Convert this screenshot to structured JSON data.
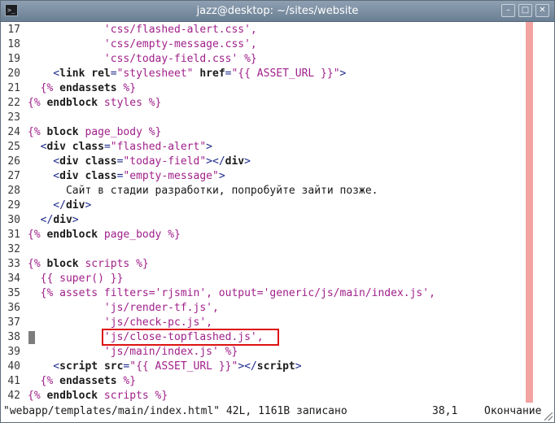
{
  "window": {
    "title": "jazz@desktop: ~/sites/website",
    "minimize_glyph": "–",
    "maximize_glyph": "□",
    "close_glyph": "✕",
    "app_icon": "terminal-icon"
  },
  "editor": {
    "lines": [
      {
        "num": "17",
        "tokens": [
          {
            "c": "string",
            "t": "            'css/flashed-alert.css',"
          }
        ]
      },
      {
        "num": "18",
        "tokens": [
          {
            "c": "string",
            "t": "            'css/empty-message.css',"
          }
        ]
      },
      {
        "num": "19",
        "tokens": [
          {
            "c": "string",
            "t": "            'css/today-field.css' %}"
          }
        ]
      },
      {
        "num": "20",
        "tokens": [
          {
            "c": "tag",
            "t": "    <"
          },
          {
            "c": "keyword",
            "t": "link"
          },
          {
            "c": "tag",
            "t": " "
          },
          {
            "c": "keyword",
            "t": "rel"
          },
          {
            "c": "tag",
            "t": "="
          },
          {
            "c": "string",
            "t": "\"stylesheet\""
          },
          {
            "c": "tag",
            "t": " "
          },
          {
            "c": "keyword",
            "t": "href"
          },
          {
            "c": "tag",
            "t": "="
          },
          {
            "c": "string",
            "t": "\"{{ ASSET_URL }}\""
          },
          {
            "c": "tag",
            "t": ">"
          }
        ]
      },
      {
        "num": "21",
        "tokens": [
          {
            "c": "statement",
            "t": "  {% "
          },
          {
            "c": "keyword",
            "t": "endassets"
          },
          {
            "c": "statement",
            "t": " %}"
          }
        ]
      },
      {
        "num": "22",
        "tokens": [
          {
            "c": "statement",
            "t": "{% "
          },
          {
            "c": "keyword",
            "t": "endblock"
          },
          {
            "c": "statement",
            "t": " styles %}"
          }
        ]
      },
      {
        "num": "23",
        "tokens": []
      },
      {
        "num": "24",
        "tokens": [
          {
            "c": "statement",
            "t": "{% "
          },
          {
            "c": "keyword",
            "t": "block"
          },
          {
            "c": "statement",
            "t": " page_body %}"
          }
        ]
      },
      {
        "num": "25",
        "tokens": [
          {
            "c": "tag",
            "t": "  <"
          },
          {
            "c": "keyword",
            "t": "div"
          },
          {
            "c": "tag",
            "t": " "
          },
          {
            "c": "keyword",
            "t": "class"
          },
          {
            "c": "tag",
            "t": "="
          },
          {
            "c": "string",
            "t": "\"flashed-alert\""
          },
          {
            "c": "tag",
            "t": ">"
          }
        ]
      },
      {
        "num": "26",
        "tokens": [
          {
            "c": "tag",
            "t": "    <"
          },
          {
            "c": "keyword",
            "t": "div"
          },
          {
            "c": "tag",
            "t": " "
          },
          {
            "c": "keyword",
            "t": "class"
          },
          {
            "c": "tag",
            "t": "="
          },
          {
            "c": "string",
            "t": "\"today-field\""
          },
          {
            "c": "tag",
            "t": "></"
          },
          {
            "c": "keyword",
            "t": "div"
          },
          {
            "c": "tag",
            "t": ">"
          }
        ]
      },
      {
        "num": "27",
        "tokens": [
          {
            "c": "tag",
            "t": "    <"
          },
          {
            "c": "keyword",
            "t": "div"
          },
          {
            "c": "tag",
            "t": " "
          },
          {
            "c": "keyword",
            "t": "class"
          },
          {
            "c": "tag",
            "t": "="
          },
          {
            "c": "string",
            "t": "\"empty-message\""
          },
          {
            "c": "tag",
            "t": ">"
          }
        ]
      },
      {
        "num": "28",
        "tokens": [
          {
            "c": "text",
            "t": "      Сайт в стадии разработки, попробуйте зайти позже."
          }
        ]
      },
      {
        "num": "29",
        "tokens": [
          {
            "c": "tag",
            "t": "    </"
          },
          {
            "c": "keyword",
            "t": "div"
          },
          {
            "c": "tag",
            "t": ">"
          }
        ]
      },
      {
        "num": "30",
        "tokens": [
          {
            "c": "tag",
            "t": "  </"
          },
          {
            "c": "keyword",
            "t": "div"
          },
          {
            "c": "tag",
            "t": ">"
          }
        ]
      },
      {
        "num": "31",
        "tokens": [
          {
            "c": "statement",
            "t": "{% "
          },
          {
            "c": "keyword",
            "t": "endblock"
          },
          {
            "c": "statement",
            "t": " page_body %}"
          }
        ]
      },
      {
        "num": "32",
        "tokens": []
      },
      {
        "num": "33",
        "tokens": [
          {
            "c": "statement",
            "t": "{% "
          },
          {
            "c": "keyword",
            "t": "block"
          },
          {
            "c": "statement",
            "t": " scripts %}"
          }
        ]
      },
      {
        "num": "34",
        "tokens": [
          {
            "c": "statement",
            "t": "  {{ super() }}"
          }
        ]
      },
      {
        "num": "35",
        "tokens": [
          {
            "c": "statement",
            "t": "  {% assets filters='rjsmin', output='generic/js/main/index.js',"
          }
        ]
      },
      {
        "num": "36",
        "tokens": [
          {
            "c": "string",
            "t": "            'js/render-tf.js',"
          }
        ]
      },
      {
        "num": "37",
        "tokens": [
          {
            "c": "string",
            "t": "            'js/check-pc.js',"
          }
        ]
      },
      {
        "num": "38",
        "tokens": [
          {
            "c": "string",
            "t": "            'js/close-topflashed.js',"
          }
        ]
      },
      {
        "num": "39",
        "tokens": [
          {
            "c": "string",
            "t": "            'js/main/index.js' %}"
          }
        ]
      },
      {
        "num": "40",
        "tokens": [
          {
            "c": "tag",
            "t": "    <"
          },
          {
            "c": "keyword",
            "t": "script"
          },
          {
            "c": "tag",
            "t": " "
          },
          {
            "c": "keyword",
            "t": "src"
          },
          {
            "c": "tag",
            "t": "="
          },
          {
            "c": "string",
            "t": "\"{{ ASSET_URL }}\""
          },
          {
            "c": "tag",
            "t": "></"
          },
          {
            "c": "keyword",
            "t": "script"
          },
          {
            "c": "tag",
            "t": ">"
          }
        ]
      },
      {
        "num": "41",
        "tokens": [
          {
            "c": "statement",
            "t": "  {% "
          },
          {
            "c": "keyword",
            "t": "endassets"
          },
          {
            "c": "statement",
            "t": " %}"
          }
        ]
      },
      {
        "num": "42",
        "tokens": [
          {
            "c": "statement",
            "t": "{% "
          },
          {
            "c": "keyword",
            "t": "endblock"
          },
          {
            "c": "statement",
            "t": " scripts %}"
          }
        ]
      }
    ],
    "colors": {
      "statement": "#a0208a",
      "tag": "#1d2a8c",
      "keyword": "#1b1b1b",
      "margin_column": "#f4a3a3",
      "highlight": "#dd1111"
    }
  },
  "status": {
    "file_info": "\"webapp/templates/main/index.html\" 42L, 1161B записано",
    "position": "38,1",
    "scroll": "Окончание"
  }
}
